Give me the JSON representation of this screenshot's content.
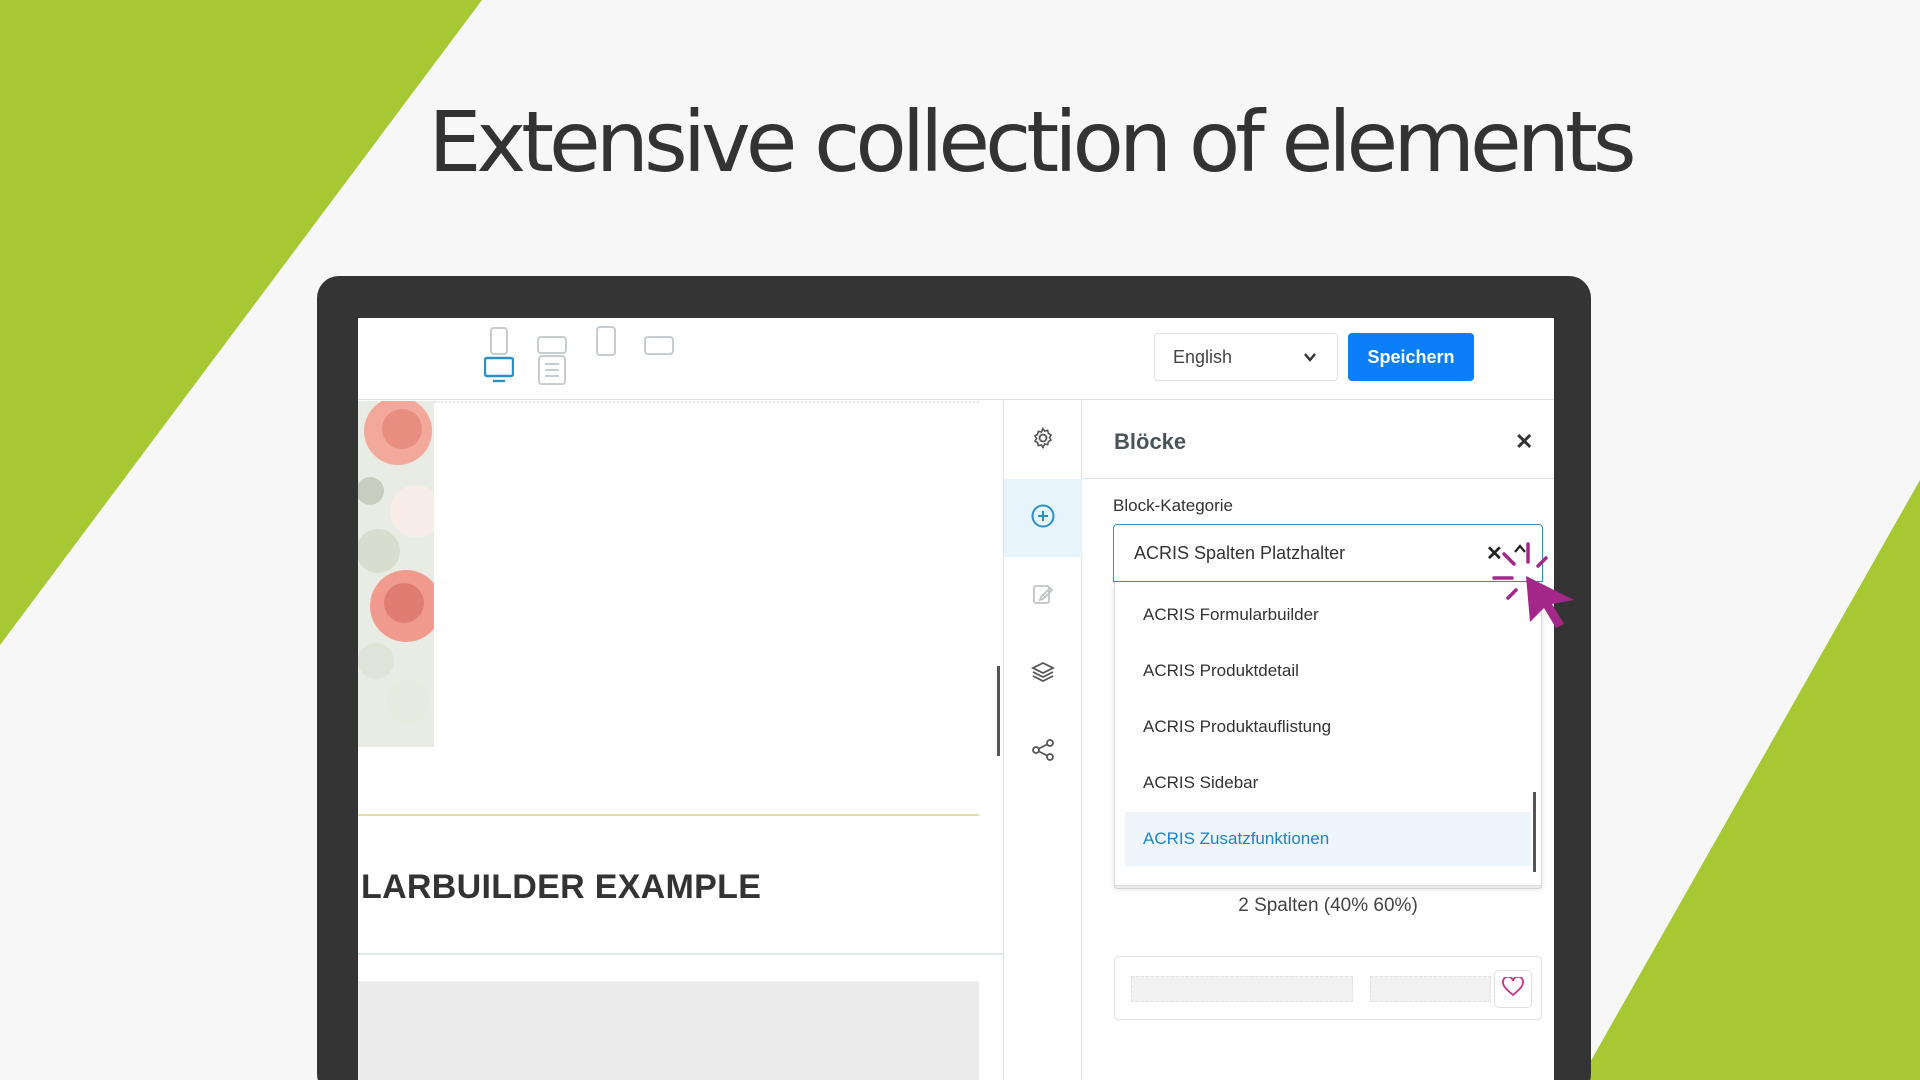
{
  "headline": "Extensive collection of elements",
  "colors": {
    "brand_green": "#a6c833",
    "primary_blue": "#0b7ef9",
    "accent_magenta": "#a4288a"
  },
  "toolbar": {
    "device_icons": [
      "smartphone-icon",
      "tablet-landscape-icon",
      "tablet-portrait-icon",
      "laptop-icon",
      "desktop-icon",
      "page-list-icon"
    ],
    "language": "English",
    "save_label": "Speichern"
  },
  "canvas": {
    "example_title": "LARBUILDER EXAMPLE"
  },
  "sidenav": {
    "items": [
      "settings-icon",
      "add-block-icon",
      "edit-icon",
      "layers-icon",
      "share-icon"
    ],
    "active": "add-block-icon"
  },
  "panel": {
    "title": "Blöcke",
    "field_label": "Block-Kategorie",
    "selected_value": "ACRIS Spalten Platzhalter",
    "dropdown_options": [
      "ACRIS Formularbuilder",
      "ACRIS Produktdetail",
      "ACRIS Produktauflistung",
      "ACRIS Sidebar",
      "ACRIS Zusatzfunktionen"
    ],
    "highlighted_option": "ACRIS Zusatzfunktionen",
    "blocks": [
      {
        "caption": "2 Spalten (40% 60%)"
      },
      {
        "caption": ""
      }
    ]
  }
}
